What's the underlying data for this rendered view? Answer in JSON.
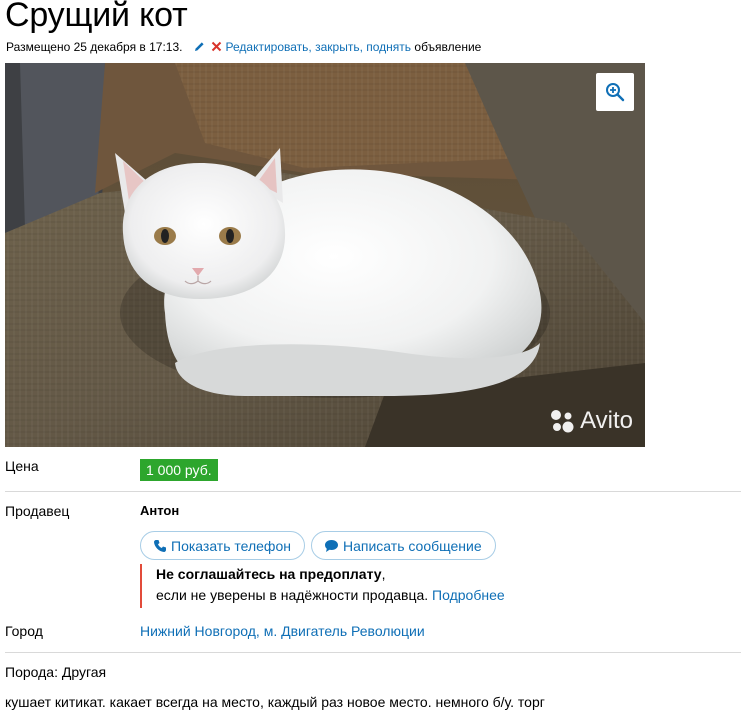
{
  "listing": {
    "title": "Срущий кот",
    "posted": "Размещено 25 декабря в 17:13.",
    "actions": {
      "edit": "Редактировать",
      "close": "закрыть",
      "raise": "поднять",
      "sep": ", ",
      "suffix": "объявление"
    }
  },
  "photo": {
    "watermark": "Avito"
  },
  "price": {
    "label": "Цена",
    "value": "1 000 руб."
  },
  "seller": {
    "label": "Продавец",
    "name": "Антон",
    "show_phone": "Показать телефон",
    "send_message": "Написать сообщение",
    "warning": {
      "headline": "Не соглашайтесь на предоплату",
      "comma": ",",
      "text": "если не уверены в надёжности продавца.",
      "more": "Подробнее"
    }
  },
  "city": {
    "label": "Город",
    "value": "Нижний Новгород, м. Двигатель Революции"
  },
  "details": {
    "breed": "Порода: Другая",
    "description": "кушает китикат. какает всегда на место, каждый раз новое место. немного б/у. торг"
  },
  "colors": {
    "link": "#0f6fb6",
    "price_badge": "#2da62d",
    "warning_border": "#e24b3a",
    "pill_border": "#a8cde6"
  }
}
